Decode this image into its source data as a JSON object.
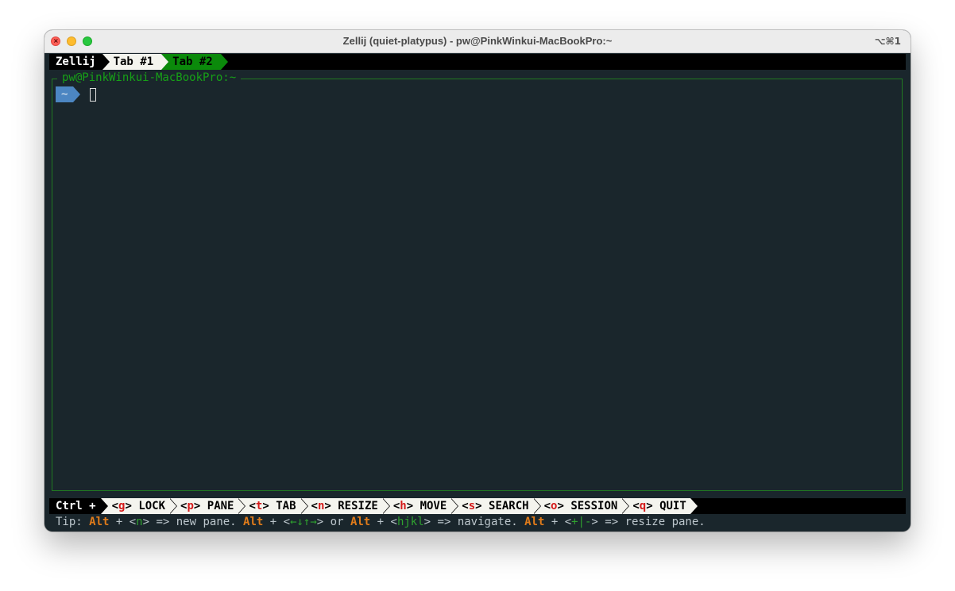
{
  "window": {
    "title": "Zellij (quiet-platypus) - pw@PinkWinkui-MacBookPro:~",
    "shortcut": "⌥⌘1"
  },
  "tabbar": {
    "app_label": "Zellij",
    "tabs": [
      {
        "label": "Tab #1",
        "active": false
      },
      {
        "label": "Tab #2",
        "active": true
      }
    ]
  },
  "pane": {
    "title": "pw@PinkWinkui-MacBookPro:~",
    "prompt": "~"
  },
  "statusbar": {
    "modifier": "Ctrl +",
    "keys": [
      {
        "key": "<g>",
        "keytext": "g",
        "action": "LOCK"
      },
      {
        "key": "<p>",
        "keytext": "p",
        "action": "PANE"
      },
      {
        "key": "<t>",
        "keytext": "t",
        "action": "TAB"
      },
      {
        "key": "<n>",
        "keytext": "n",
        "action": "RESIZE"
      },
      {
        "key": "<h>",
        "keytext": "h",
        "action": "MOVE"
      },
      {
        "key": "<s>",
        "keytext": "s",
        "action": "SEARCH"
      },
      {
        "key": "<o>",
        "keytext": "o",
        "action": "SESSION"
      },
      {
        "key": "<q>",
        "keytext": "q",
        "action": "QUIT"
      }
    ]
  },
  "tip": {
    "prefix": "Tip: ",
    "alt": "Alt",
    "plus": " + <",
    "new_key": "n",
    "new_text": "> => new pane. ",
    "nav_arrows": "←↓↑→",
    "or_text": "> or ",
    "hjkl": "hjkl",
    "navigate_text": "> => navigate. ",
    "resize_keys": "+|-",
    "resize_text": "> => resize pane."
  },
  "colors": {
    "terminal_bg": "#1a262c",
    "accent_green": "#0b8a0b",
    "key_red": "#d41a1a",
    "alt_orange": "#e07b1a",
    "prompt_blue": "#4c86c2"
  }
}
